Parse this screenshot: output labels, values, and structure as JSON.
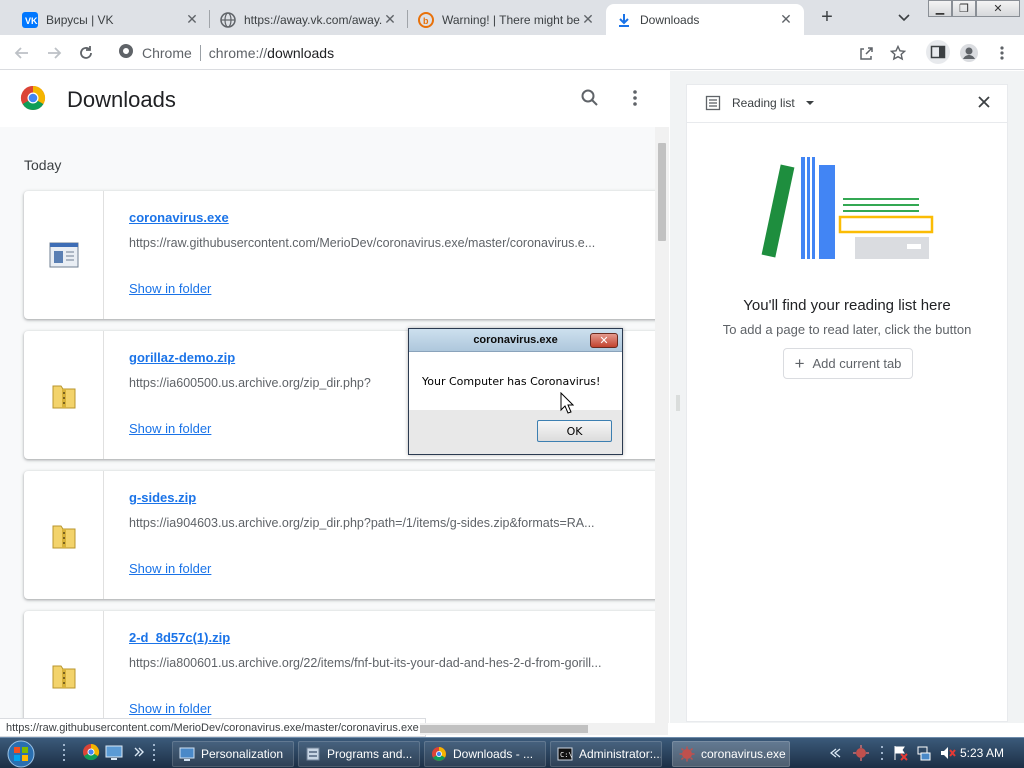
{
  "tabs": [
    {
      "title": "Вирусы | VK",
      "favicon": "vk-icon"
    },
    {
      "title": "https://away.vk.com/away.p",
      "favicon": "globe-icon"
    },
    {
      "title": "Warning! | There might be a",
      "favicon": "warning-site-icon"
    },
    {
      "title": "Downloads",
      "favicon": "download-icon",
      "active": true
    }
  ],
  "toolbar": {
    "omnibox_site_label": "Chrome",
    "omnibox_url_scheme": "chrome://",
    "omnibox_url_path": "downloads"
  },
  "downloads_page": {
    "title": "Downloads",
    "date_group": "Today",
    "show_in_folder_label": "Show in folder",
    "items": [
      {
        "filename": "coronavirus.exe",
        "url": "https://raw.githubusercontent.com/MerioDev/coronavirus.exe/master/coronavirus.e...",
        "icon": "exe-file-icon"
      },
      {
        "filename": "gorillaz-demo.zip",
        "url": "https://ia600500.us.archive.org/zip_dir.php?",
        "icon": "zip-folder-icon"
      },
      {
        "filename": "g-sides.zip",
        "url": "https://ia904603.us.archive.org/zip_dir.php?path=/1/items/g-sides.zip&formats=RA...",
        "icon": "zip-folder-icon"
      },
      {
        "filename": "2-d_8d57c(1).zip",
        "url": "https://ia800601.us.archive.org/22/items/fnf-but-its-your-dad-and-hes-2-d-from-gorill...",
        "icon": "zip-folder-icon"
      }
    ]
  },
  "side_panel": {
    "title": "Reading list",
    "empty_title": "You'll find your reading list here",
    "empty_subtitle": "To add a page to read later, click the button",
    "add_button_label": "Add current tab"
  },
  "status_bubble": "https://raw.githubusercontent.com/MerioDev/coronavirus.exe/master/coronavirus.exe",
  "dialog": {
    "title": "coronavirus.exe",
    "message": "Your Computer has Coronavirus!",
    "ok_label": "OK",
    "close_glyph": "✕"
  },
  "taskbar": {
    "tasks": [
      {
        "label": "Personalization",
        "icon": "personalization-icon"
      },
      {
        "label": "Programs and...",
        "icon": "programs-icon"
      },
      {
        "label": "Downloads - ...",
        "icon": "chrome-icon"
      },
      {
        "label": "Administrator:...",
        "icon": "cmd-icon"
      },
      {
        "label": "coronavirus.exe",
        "icon": "coronavirus-app-icon",
        "active": true
      }
    ],
    "clock": "5:23 AM"
  },
  "colors": {
    "accent_link": "#1a73e8",
    "tabstrip_bg": "#dee1e6",
    "taskbar_bg": "#1c2f45"
  }
}
